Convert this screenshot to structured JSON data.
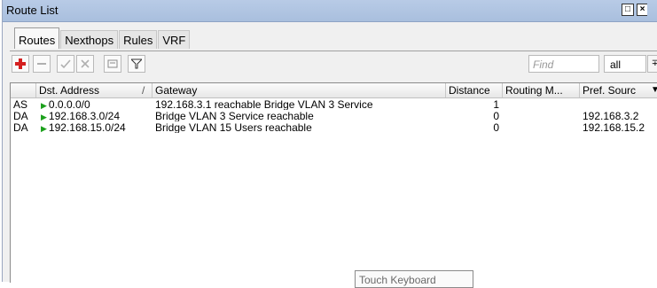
{
  "window": {
    "title": "Route List",
    "max_label": "□",
    "close_label": "×"
  },
  "tabs": [
    {
      "label": "Routes",
      "active": true
    },
    {
      "label": "Nexthops"
    },
    {
      "label": "Rules"
    },
    {
      "label": "VRF"
    }
  ],
  "toolbar": {
    "icons": [
      "add-icon",
      "remove-icon",
      "enable-icon",
      "disable-icon",
      "comment-icon",
      "filter-icon"
    ],
    "find_placeholder": "Find",
    "filter_select_value": "all",
    "dropdown_glyph": "∓"
  },
  "table": {
    "columns": [
      {
        "label": ""
      },
      {
        "label": "Dst. Address",
        "sort": "/"
      },
      {
        "label": "Gateway"
      },
      {
        "label": "Distance"
      },
      {
        "label": "Routing M..."
      },
      {
        "label": "Pref. Sourc"
      }
    ],
    "rows": [
      {
        "flags": "AS",
        "dst": "0.0.0.0/0",
        "gateway": "192.168.3.1 reachable Bridge VLAN  3  Service",
        "distance": "1",
        "routing_mark": "",
        "pref_source": ""
      },
      {
        "flags": "DA",
        "dst": "192.168.3.0/24",
        "gateway": "Bridge VLAN  3  Service reachable",
        "distance": "0",
        "routing_mark": "",
        "pref_source": "192.168.3.2"
      },
      {
        "flags": "DA",
        "dst": "192.168.15.0/24",
        "gateway": "Bridge VLAN  15  Users reachable",
        "distance": "0",
        "routing_mark": "",
        "pref_source": "192.168.15.2"
      }
    ]
  },
  "tooltip": {
    "text": "Touch Keyboard"
  },
  "colors": {
    "titlebar": "#b0c6e3",
    "route_arrow": "#1ca01c",
    "add_red": "#d42020"
  }
}
